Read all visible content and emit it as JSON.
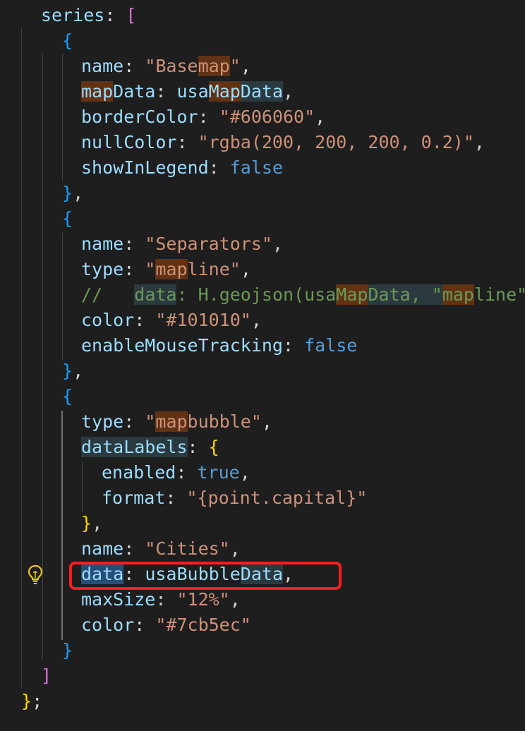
{
  "code": {
    "l1": {
      "key": "series",
      "colon": ": ",
      "open": "["
    },
    "l2": {
      "open": "{"
    },
    "l3": {
      "key": "name",
      "colon": ": ",
      "v1": "\"Base",
      "v2": "map",
      "v3": "\"",
      "tail": ","
    },
    "l4": {
      "k1": "map",
      "k2": "Data",
      "colon": ": ",
      "v1": "usa",
      "v2": "Map",
      "v3": "Data",
      "tail": ","
    },
    "l5": {
      "key": "borderColor",
      "colon": ": ",
      "value": "\"#606060\"",
      "tail": ","
    },
    "l6": {
      "key": "nullColor",
      "colon": ": ",
      "value": "\"rgba(200, 200, 200, 0.2)\"",
      "tail": ","
    },
    "l7": {
      "key": "showInLegend",
      "colon": ": ",
      "value": "false"
    },
    "l8": {
      "close": "}",
      "tail": ","
    },
    "l9": {
      "open": "{"
    },
    "l10": {
      "key": "name",
      "colon": ": ",
      "value": "\"Separators\"",
      "tail": ","
    },
    "l11": {
      "key": "type",
      "colon": ": ",
      "v1": "\"",
      "v2": "map",
      "v3": "line\"",
      "tail": ","
    },
    "l12": {
      "c1": "//   ",
      "c2": "data",
      "c3": ": H.geojson(usa",
      "c4": "Map",
      "c5": "Data, \"",
      "c6": "map",
      "c7": "line\"),",
      "full": "//   data: H.geojson(usaMapData, \"mapline\"),"
    },
    "l13": {
      "key": "color",
      "colon": ": ",
      "value": "\"#101010\"",
      "tail": ","
    },
    "l14": {
      "key": "enableMouseTracking",
      "colon": ": ",
      "value": "false"
    },
    "l15": {
      "close": "}",
      "tail": ","
    },
    "l16": {
      "open": "{"
    },
    "l17": {
      "key": "type",
      "colon": ": ",
      "v1": "\"",
      "v2": "map",
      "v3": "bubble\"",
      "tail": ","
    },
    "l18": {
      "key": "dataLabels",
      "colon": ": ",
      "open": "{"
    },
    "l19": {
      "key": "enabled",
      "colon": ": ",
      "value": "true",
      "tail": ","
    },
    "l20": {
      "key": "format",
      "colon": ": ",
      "value": "\"{point.capital}\""
    },
    "l21": {
      "close": "}",
      "tail": ","
    },
    "l22": {
      "key": "name",
      "colon": ": ",
      "value": "\"Cities\"",
      "tail": ","
    },
    "l23": {
      "key": "data",
      "colon": ": ",
      "v1": "usaBubble",
      "v2": "Data",
      "tail": ","
    },
    "l24": {
      "key": "maxSize",
      "colon": ": ",
      "value": "\"12%\"",
      "tail": ","
    },
    "l25": {
      "key": "color",
      "colon": ": ",
      "value": "\"#7cb5ec\""
    },
    "l26": {
      "close": "}"
    },
    "l27": {
      "close": "]"
    },
    "l28": {
      "close": "}",
      "tail": ";"
    }
  },
  "colors": {
    "background": "#1e1e1e",
    "property": "#9cdcfe",
    "string": "#ce9178",
    "keyword": "#569cd6",
    "comment": "#6a9955",
    "annotation_box": "#ff1e1e"
  },
  "icons": {
    "gutter": "lightbulb-icon"
  }
}
